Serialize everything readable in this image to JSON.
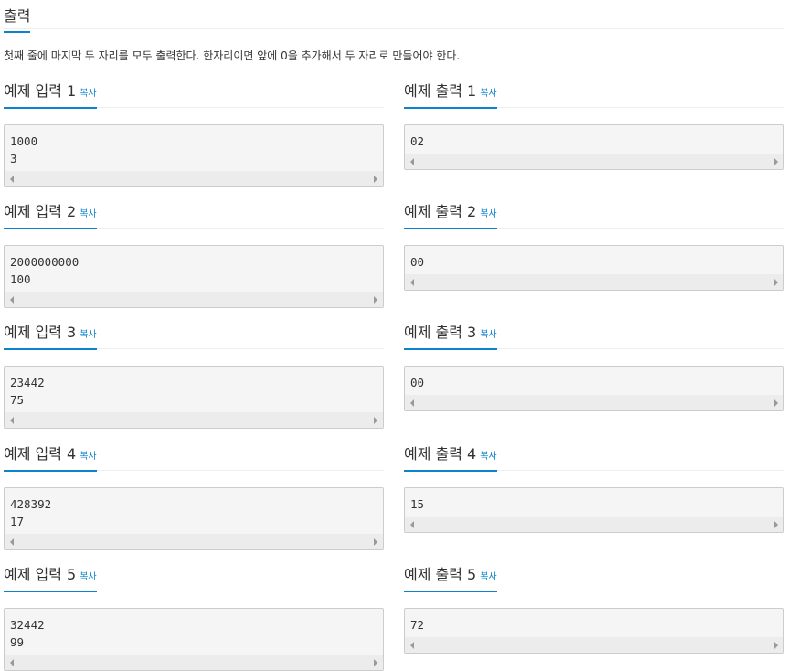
{
  "section": {
    "title": "출력"
  },
  "description": "첫째 줄에 마지막 두 자리를 모두 출력한다. 한자리이면 앞에 0을 추가해서 두 자리로 만들어야 한다.",
  "copy_label": "복사",
  "examples": [
    {
      "input_title": "예제 입력 1",
      "input_lines": [
        "1000",
        "3"
      ],
      "output_title": "예제 출력 1",
      "output_lines": [
        "02"
      ]
    },
    {
      "input_title": "예제 입력 2",
      "input_lines": [
        "2000000000",
        "100"
      ],
      "output_title": "예제 출력 2",
      "output_lines": [
        "00"
      ]
    },
    {
      "input_title": "예제 입력 3",
      "input_lines": [
        "23442",
        "75"
      ],
      "output_title": "예제 출력 3",
      "output_lines": [
        "00"
      ]
    },
    {
      "input_title": "예제 입력 4",
      "input_lines": [
        "428392",
        "17"
      ],
      "output_title": "예제 출력 4",
      "output_lines": [
        "15"
      ]
    },
    {
      "input_title": "예제 입력 5",
      "input_lines": [
        "32442",
        "99"
      ],
      "output_title": "예제 출력 5",
      "output_lines": [
        "72"
      ]
    }
  ]
}
